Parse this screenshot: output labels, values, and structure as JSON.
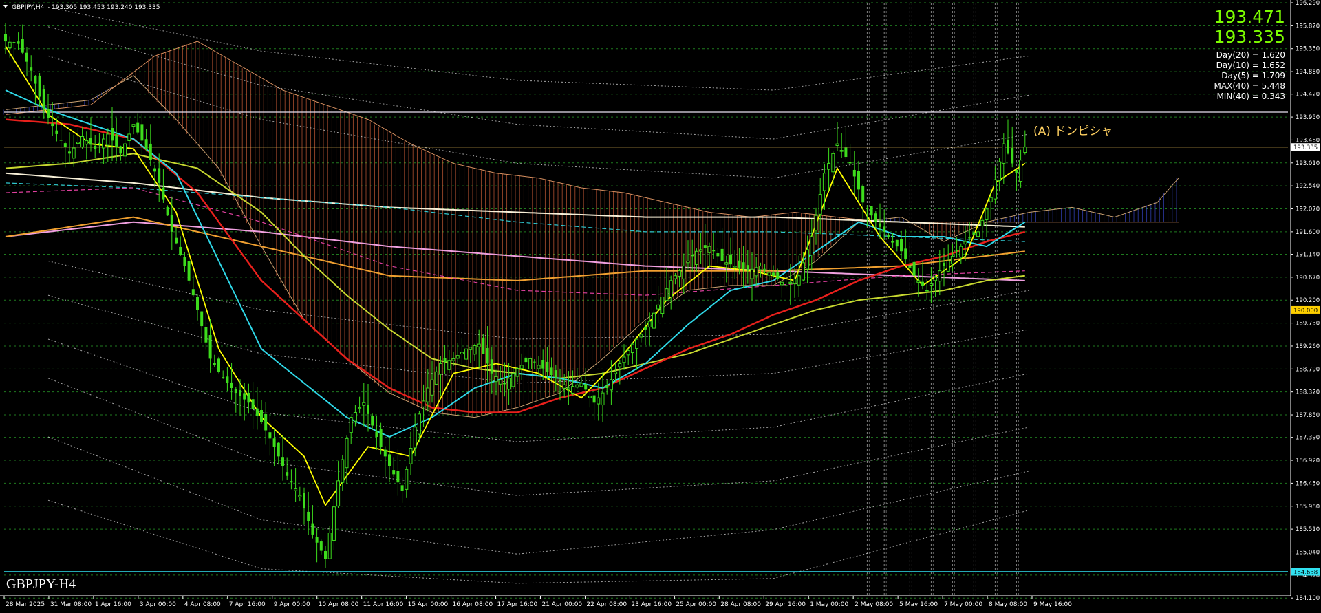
{
  "header": {
    "symbol": "GBPJPY,H4",
    "ohlc": "193.305 193.453 193.240 193.335",
    "menu_icon": "triangle-down-icon"
  },
  "watermark": "GBPJPY-H4",
  "price_panel": {
    "ask": "193.471",
    "bid": "193.335",
    "stats": [
      "Day(20) = 1.620",
      "Day(10) = 1.652",
      "Day(5) = 1.709",
      "MAX(40) = 5.448",
      "MIN(40) = 0.343"
    ]
  },
  "annotation": "(A) ドンピシャ",
  "colors": {
    "background": "#000000",
    "grid": "#1f7a1f",
    "candle": "#3ddc1c",
    "ma_yellow": "#ffff00",
    "ma_cyan": "#2fd8e8",
    "ma_red": "#e8201c",
    "ma_olive": "#c8d830",
    "ma_orange": "#f0a030",
    "ma_pink": "#f0a0e0",
    "ma_white": "#f8f0d8",
    "kumo_bear": "#d0603a",
    "kumo_bull": "#3a4ad0",
    "hline_cyan": "#31e1f0",
    "hline_yellow": "#ffd060",
    "ask_text": "#7cfc00"
  },
  "chart_data": {
    "type": "candlestick",
    "symbol": "GBPJPY",
    "timeframe": "H4",
    "ylim": [
      184.145,
      196.29
    ],
    "y_ticks": [
      "196.290",
      "195.820",
      "195.350",
      "194.880",
      "194.420",
      "193.950",
      "193.480",
      "193.010",
      "192.540",
      "192.070",
      "191.600",
      "191.140",
      "190.670",
      "190.200",
      "189.730",
      "189.260",
      "188.790",
      "188.320",
      "187.850",
      "187.390",
      "186.920",
      "186.450",
      "185.980",
      "185.510",
      "185.040",
      "184.570",
      "184.100"
    ],
    "x_ticks": [
      "28 Mar 2025",
      "31 Mar 08:00",
      "1 Apr 16:00",
      "3 Apr 00:00",
      "4 Apr 08:00",
      "7 Apr 16:00",
      "9 Apr 00:00",
      "10 Apr 08:00",
      "11 Apr 16:00",
      "15 Apr 00:00",
      "16 Apr 08:00",
      "17 Apr 16:00",
      "21 Apr 00:00",
      "22 Apr 08:00",
      "23 Apr 16:00",
      "25 Apr 00:00",
      "28 Apr 08:00",
      "29 Apr 16:00",
      "1 May 00:00",
      "2 May 08:00",
      "5 May 16:00",
      "7 May 00:00",
      "8 May 08:00",
      "9 May 16:00"
    ],
    "price_labels": [
      {
        "value": 193.335,
        "label": "193.335"
      },
      {
        "value": 190.0,
        "label": "190.000"
      },
      {
        "value": 184.638,
        "label": "184.638"
      }
    ],
    "horizontal_lines": [
      {
        "name": "resistance",
        "value": 194.05
      },
      {
        "name": "current",
        "value": 193.335
      },
      {
        "name": "support",
        "value": 184.638
      }
    ],
    "close_anchors": [
      [
        0,
        195.5
      ],
      [
        3,
        195.45
      ],
      [
        6,
        194.9
      ],
      [
        9,
        194.1
      ],
      [
        12,
        193.6
      ],
      [
        15,
        193.2
      ],
      [
        18,
        193.55
      ],
      [
        21,
        193.3
      ],
      [
        24,
        193.6
      ],
      [
        27,
        193.2
      ],
      [
        30,
        193.8
      ],
      [
        33,
        193.3
      ],
      [
        36,
        192.6
      ],
      [
        39,
        191.6
      ],
      [
        42,
        190.9
      ],
      [
        45,
        190.0
      ],
      [
        48,
        189.0
      ],
      [
        51,
        188.6
      ],
      [
        54,
        188.3
      ],
      [
        57,
        188.1
      ],
      [
        60,
        187.7
      ],
      [
        63,
        187.2
      ],
      [
        66,
        186.6
      ],
      [
        69,
        186.2
      ],
      [
        72,
        185.4
      ],
      [
        75,
        184.9
      ],
      [
        78,
        186.5
      ],
      [
        81,
        187.8
      ],
      [
        84,
        188.1
      ],
      [
        87,
        187.4
      ],
      [
        90,
        186.8
      ],
      [
        93,
        186.3
      ],
      [
        96,
        187.6
      ],
      [
        99,
        188.4
      ],
      [
        102,
        188.9
      ],
      [
        105,
        189.0
      ],
      [
        108,
        189.2
      ],
      [
        111,
        189.3
      ],
      [
        114,
        188.7
      ],
      [
        117,
        188.5
      ],
      [
        120,
        188.8
      ],
      [
        123,
        189.0
      ],
      [
        126,
        188.8
      ],
      [
        129,
        188.6
      ],
      [
        132,
        188.4
      ],
      [
        135,
        188.5
      ],
      [
        138,
        188.1
      ],
      [
        141,
        188.4
      ],
      [
        144,
        188.9
      ],
      [
        147,
        189.3
      ],
      [
        150,
        189.6
      ],
      [
        153,
        190.1
      ],
      [
        156,
        190.6
      ],
      [
        159,
        190.9
      ],
      [
        162,
        191.2
      ],
      [
        165,
        191.3
      ],
      [
        168,
        191.0
      ],
      [
        171,
        190.9
      ],
      [
        174,
        190.8
      ],
      [
        177,
        190.9
      ],
      [
        180,
        190.7
      ],
      [
        183,
        190.5
      ],
      [
        186,
        190.7
      ],
      [
        189,
        191.5
      ],
      [
        192,
        192.8
      ],
      [
        195,
        193.4
      ],
      [
        198,
        193.0
      ],
      [
        201,
        192.2
      ],
      [
        204,
        191.8
      ],
      [
        207,
        191.5
      ],
      [
        210,
        191.2
      ],
      [
        213,
        190.7
      ],
      [
        216,
        190.4
      ],
      [
        219,
        190.8
      ],
      [
        222,
        191.1
      ],
      [
        225,
        191.4
      ],
      [
        228,
        191.6
      ],
      [
        231,
        192.3
      ],
      [
        234,
        193.4
      ],
      [
        237,
        192.8
      ],
      [
        239,
        193.335
      ]
    ],
    "ma_anchors": {
      "yellow_fast": [
        [
          0,
          195.4
        ],
        [
          10,
          194.0
        ],
        [
          20,
          193.4
        ],
        [
          30,
          193.3
        ],
        [
          40,
          192.0
        ],
        [
          50,
          189.2
        ],
        [
          60,
          187.8
        ],
        [
          70,
          187.0
        ],
        [
          75,
          186.0
        ],
        [
          85,
          187.2
        ],
        [
          95,
          187.0
        ],
        [
          105,
          188.7
        ],
        [
          115,
          188.9
        ],
        [
          125,
          188.7
        ],
        [
          135,
          188.2
        ],
        [
          145,
          189.1
        ],
        [
          155,
          190.2
        ],
        [
          165,
          190.9
        ],
        [
          175,
          190.8
        ],
        [
          185,
          190.6
        ],
        [
          195,
          192.9
        ],
        [
          205,
          191.5
        ],
        [
          215,
          190.5
        ],
        [
          225,
          191.1
        ],
        [
          232,
          192.6
        ],
        [
          239,
          193.0
        ]
      ],
      "cyan": [
        [
          0,
          194.5
        ],
        [
          10,
          194.1
        ],
        [
          20,
          193.8
        ],
        [
          30,
          193.5
        ],
        [
          40,
          192.8
        ],
        [
          50,
          191.0
        ],
        [
          60,
          189.2
        ],
        [
          70,
          188.5
        ],
        [
          80,
          187.8
        ],
        [
          90,
          187.4
        ],
        [
          100,
          187.8
        ],
        [
          110,
          188.4
        ],
        [
          120,
          188.7
        ],
        [
          130,
          188.6
        ],
        [
          140,
          188.4
        ],
        [
          150,
          188.9
        ],
        [
          160,
          189.7
        ],
        [
          170,
          190.4
        ],
        [
          180,
          190.6
        ],
        [
          190,
          191.2
        ],
        [
          200,
          191.8
        ],
        [
          210,
          191.5
        ],
        [
          220,
          191.5
        ],
        [
          230,
          191.3
        ],
        [
          239,
          191.8
        ]
      ],
      "red": [
        [
          0,
          193.9
        ],
        [
          15,
          193.8
        ],
        [
          30,
          193.5
        ],
        [
          45,
          192.4
        ],
        [
          60,
          190.6
        ],
        [
          70,
          189.8
        ],
        [
          80,
          189.0
        ],
        [
          90,
          188.4
        ],
        [
          100,
          188.0
        ],
        [
          110,
          187.9
        ],
        [
          120,
          187.9
        ],
        [
          130,
          188.2
        ],
        [
          140,
          188.4
        ],
        [
          150,
          188.8
        ],
        [
          160,
          189.2
        ],
        [
          170,
          189.5
        ],
        [
          180,
          189.9
        ],
        [
          190,
          190.2
        ],
        [
          200,
          190.6
        ],
        [
          210,
          190.9
        ],
        [
          220,
          191.1
        ],
        [
          230,
          191.4
        ],
        [
          239,
          191.6
        ]
      ],
      "olive": [
        [
          0,
          192.9
        ],
        [
          15,
          193.0
        ],
        [
          30,
          193.2
        ],
        [
          45,
          192.9
        ],
        [
          60,
          192.0
        ],
        [
          70,
          191.1
        ],
        [
          80,
          190.3
        ],
        [
          90,
          189.6
        ],
        [
          100,
          189.0
        ],
        [
          110,
          188.8
        ],
        [
          120,
          188.7
        ],
        [
          130,
          188.6
        ],
        [
          140,
          188.7
        ],
        [
          150,
          188.9
        ],
        [
          160,
          189.1
        ],
        [
          170,
          189.4
        ],
        [
          180,
          189.7
        ],
        [
          190,
          190.0
        ],
        [
          200,
          190.2
        ],
        [
          210,
          190.3
        ],
        [
          220,
          190.4
        ],
        [
          230,
          190.6
        ],
        [
          239,
          190.7
        ]
      ],
      "orange_dashed": [
        [
          0,
          191.5
        ],
        [
          30,
          191.9
        ],
        [
          60,
          191.3
        ],
        [
          90,
          190.7
        ],
        [
          120,
          190.6
        ],
        [
          150,
          190.8
        ],
        [
          180,
          190.8
        ],
        [
          210,
          190.9
        ],
        [
          239,
          191.2
        ]
      ],
      "pink": [
        [
          0,
          191.5
        ],
        [
          30,
          191.8
        ],
        [
          60,
          191.6
        ],
        [
          90,
          191.3
        ],
        [
          120,
          191.1
        ],
        [
          150,
          190.9
        ],
        [
          180,
          190.8
        ],
        [
          210,
          190.7
        ],
        [
          239,
          190.6
        ]
      ],
      "white": [
        [
          0,
          192.8
        ],
        [
          30,
          192.6
        ],
        [
          60,
          192.3
        ],
        [
          90,
          192.1
        ],
        [
          120,
          192.0
        ],
        [
          150,
          191.9
        ],
        [
          180,
          191.9
        ],
        [
          210,
          191.8
        ],
        [
          239,
          191.7
        ]
      ],
      "teal_dashed": [
        [
          0,
          192.6
        ],
        [
          30,
          192.5
        ],
        [
          60,
          192.3
        ],
        [
          90,
          192.1
        ],
        [
          120,
          191.8
        ],
        [
          150,
          191.6
        ],
        [
          180,
          191.6
        ],
        [
          210,
          191.5
        ],
        [
          239,
          191.4
        ]
      ],
      "magenta_dashed": [
        [
          0,
          192.4
        ],
        [
          30,
          192.5
        ],
        [
          60,
          191.8
        ],
        [
          90,
          190.9
        ],
        [
          120,
          190.4
        ],
        [
          150,
          190.3
        ],
        [
          180,
          190.5
        ],
        [
          210,
          190.7
        ],
        [
          239,
          190.8
        ]
      ]
    },
    "kumo": {
      "span_a": [
        [
          0,
          194.1
        ],
        [
          20,
          194.3
        ],
        [
          30,
          194.8
        ],
        [
          40,
          193.9
        ],
        [
          50,
          192.9
        ],
        [
          60,
          191.3
        ],
        [
          70,
          189.8
        ],
        [
          80,
          189.0
        ],
        [
          90,
          188.3
        ],
        [
          100,
          187.9
        ],
        [
          110,
          187.8
        ],
        [
          120,
          188.0
        ],
        [
          130,
          188.3
        ],
        [
          140,
          189.0
        ],
        [
          150,
          189.8
        ],
        [
          160,
          190.4
        ],
        [
          170,
          190.5
        ],
        [
          180,
          190.5
        ],
        [
          190,
          191.0
        ],
        [
          200,
          191.8
        ],
        [
          210,
          191.9
        ],
        [
          220,
          191.4
        ],
        [
          230,
          191.8
        ],
        [
          240,
          192.0
        ],
        [
          250,
          192.1
        ],
        [
          260,
          191.9
        ],
        [
          270,
          192.2
        ],
        [
          275,
          192.7
        ]
      ],
      "span_b": [
        [
          0,
          194.0
        ],
        [
          20,
          194.2
        ],
        [
          35,
          195.2
        ],
        [
          45,
          195.5
        ],
        [
          55,
          195.0
        ],
        [
          65,
          194.5
        ],
        [
          75,
          194.2
        ],
        [
          85,
          193.9
        ],
        [
          95,
          193.4
        ],
        [
          105,
          193.0
        ],
        [
          115,
          192.8
        ],
        [
          125,
          192.7
        ],
        [
          135,
          192.5
        ],
        [
          145,
          192.4
        ],
        [
          155,
          192.2
        ],
        [
          165,
          192.0
        ],
        [
          175,
          191.9
        ],
        [
          185,
          192.0
        ],
        [
          195,
          191.9
        ],
        [
          205,
          191.8
        ],
        [
          215,
          191.8
        ],
        [
          225,
          191.8
        ],
        [
          235,
          191.8
        ],
        [
          245,
          191.8
        ],
        [
          255,
          191.8
        ],
        [
          265,
          191.8
        ],
        [
          275,
          191.8
        ]
      ]
    },
    "band_lines": [
      [
        [
          10,
          196.2
        ],
        [
          60,
          195.3
        ],
        [
          120,
          194.7
        ],
        [
          180,
          194.5
        ],
        [
          240,
          195.2
        ]
      ],
      [
        [
          10,
          195.8
        ],
        [
          60,
          194.6
        ],
        [
          120,
          193.8
        ],
        [
          180,
          193.5
        ],
        [
          240,
          194.4
        ]
      ],
      [
        [
          10,
          195.2
        ],
        [
          60,
          193.9
        ],
        [
          120,
          193.0
        ],
        [
          180,
          192.7
        ],
        [
          240,
          193.6
        ]
      ],
      [
        [
          10,
          191.0
        ],
        [
          60,
          190.0
        ],
        [
          120,
          189.4
        ],
        [
          180,
          189.5
        ],
        [
          240,
          190.4
        ]
      ],
      [
        [
          10,
          190.3
        ],
        [
          60,
          189.1
        ],
        [
          120,
          188.5
        ],
        [
          180,
          188.7
        ],
        [
          240,
          189.6
        ]
      ],
      [
        [
          10,
          189.4
        ],
        [
          60,
          187.9
        ],
        [
          120,
          187.3
        ],
        [
          180,
          187.6
        ],
        [
          240,
          188.7
        ]
      ],
      [
        [
          10,
          188.6
        ],
        [
          60,
          186.9
        ],
        [
          120,
          186.2
        ],
        [
          180,
          186.5
        ],
        [
          240,
          187.6
        ]
      ],
      [
        [
          10,
          187.4
        ],
        [
          60,
          185.7
        ],
        [
          120,
          185.0
        ],
        [
          180,
          185.5
        ],
        [
          240,
          186.7
        ]
      ],
      [
        [
          10,
          186.1
        ],
        [
          60,
          184.7
        ],
        [
          120,
          184.4
        ],
        [
          180,
          184.5
        ],
        [
          240,
          185.9
        ]
      ]
    ],
    "vertical_session_lines": [
      202,
      206,
      212,
      217,
      222,
      227,
      232,
      237
    ],
    "num_bars": 240
  }
}
